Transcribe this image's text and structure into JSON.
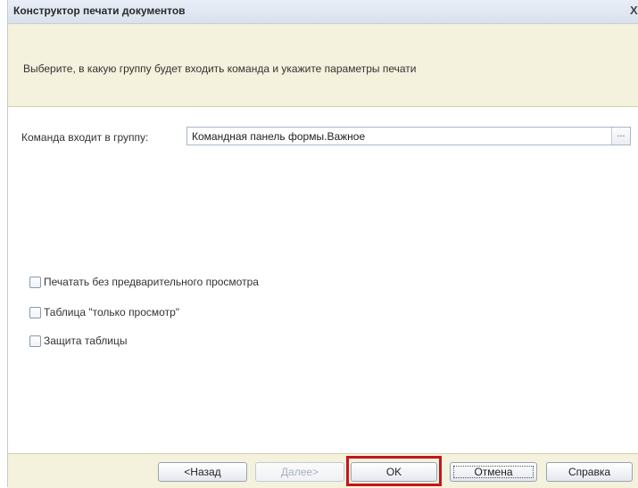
{
  "window": {
    "title": "Конструктор печати документов",
    "close_symbol": "X"
  },
  "header": {
    "instruction": "Выберите, в какую группу будет входить команда и укажите параметры печати"
  },
  "group": {
    "label": "Команда входит в группу:",
    "value": "Командная панель формы.Важное",
    "select_button": "..."
  },
  "options": [
    {
      "label": "Печатать без предварительного просмотра",
      "checked": false
    },
    {
      "label": "Таблица \"только просмотр\"",
      "checked": false
    },
    {
      "label": "Защита таблицы",
      "checked": false
    }
  ],
  "buttons": {
    "back": "<Назад",
    "next": "Далее>",
    "ok": "OK",
    "cancel": "Отмена",
    "help": "Справка"
  },
  "colors": {
    "highlight": "#c3161c",
    "panel_background": "#f4f1dc"
  }
}
